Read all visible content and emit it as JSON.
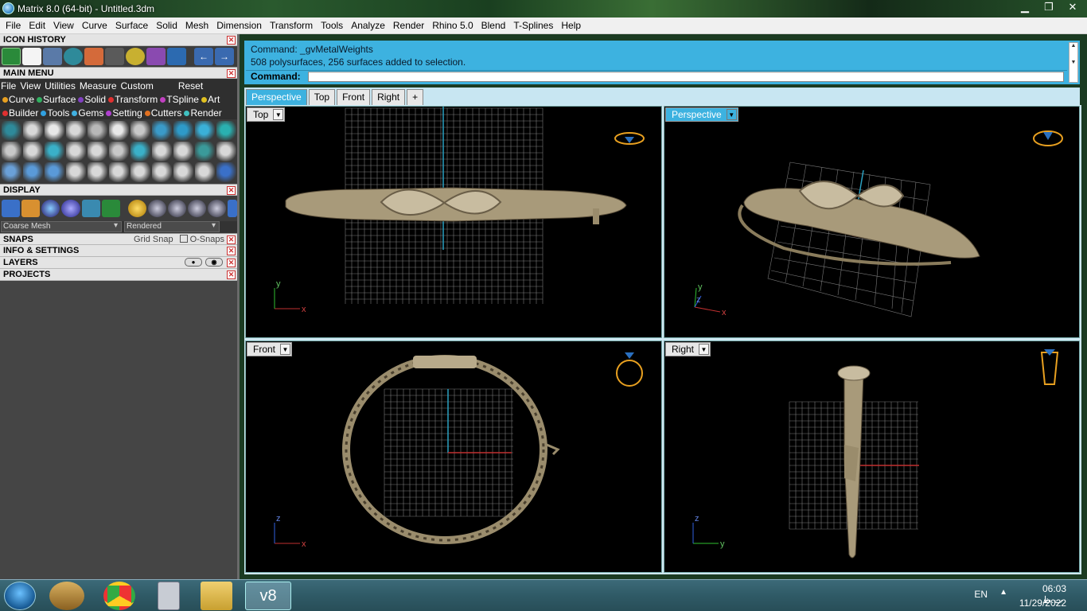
{
  "window": {
    "title": "Matrix 8.0 (64-bit) - Untitled.3dm",
    "min": "▁",
    "max": "❐",
    "close": "✕"
  },
  "menubar": [
    "File",
    "Edit",
    "View",
    "Curve",
    "Surface",
    "Solid",
    "Mesh",
    "Dimension",
    "Transform",
    "Tools",
    "Analyze",
    "Render",
    "Rhino 5.0",
    "Blend",
    "T-Splines",
    "Help"
  ],
  "panel": {
    "icon_history": "ICON HISTORY",
    "main_menu": "MAIN MENU",
    "main_menu_items": [
      "File",
      "View",
      "Utilities",
      "Measure",
      "Custom"
    ],
    "reset": "Reset",
    "row1": [
      {
        "label": "Curve",
        "color": "#e8a020"
      },
      {
        "label": "Surface",
        "color": "#30b060"
      },
      {
        "label": "Solid",
        "color": "#8040c0"
      },
      {
        "label": "Transform",
        "color": "#e03030"
      },
      {
        "label": "TSpline",
        "color": "#c040c0"
      },
      {
        "label": "Art",
        "color": "#e0c020"
      }
    ],
    "row2": [
      {
        "label": "Builder",
        "color": "#e03030"
      },
      {
        "label": "Tools",
        "color": "#30a0e0"
      },
      {
        "label": "Gems",
        "color": "#40b0e0"
      },
      {
        "label": "Setting",
        "color": "#b040d0"
      },
      {
        "label": "Cutters",
        "color": "#e07020"
      },
      {
        "label": "Render",
        "color": "#40c0c0"
      }
    ],
    "display": "DISPLAY",
    "mesh_select": "Coarse Mesh",
    "render_select": "Rendered",
    "snaps": "SNAPS",
    "grid_snap": "Grid Snap",
    "o_snaps": "O-Snaps",
    "info": "INFO & SETTINGS",
    "layers": "LAYERS",
    "projects": "PROJECTS"
  },
  "command": {
    "line1": "Command: _gvMetalWeights",
    "line2": "508 polysurfaces, 256 surfaces added to selection.",
    "prompt": "Command:"
  },
  "tabs": [
    "Perspective",
    "Top",
    "Front",
    "Right",
    "+"
  ],
  "viewports": {
    "top": {
      "label": "Top",
      "axis_a": "y",
      "axis_b": "x"
    },
    "perspective": {
      "label": "Perspective",
      "axis_a": "y",
      "axis_b": "x",
      "axis_c": "z"
    },
    "front": {
      "label": "Front",
      "axis_a": "z",
      "axis_b": "x"
    },
    "right": {
      "label": "Right",
      "axis_a": "z",
      "axis_b": "y"
    }
  },
  "taskbar": {
    "lang": "EN",
    "time": "06:03 ب.ظ",
    "date": "11/29/2022"
  },
  "colors": {
    "accent": "#3db2e0",
    "gold": "#b8a888",
    "grid": "#8a8a8a"
  }
}
